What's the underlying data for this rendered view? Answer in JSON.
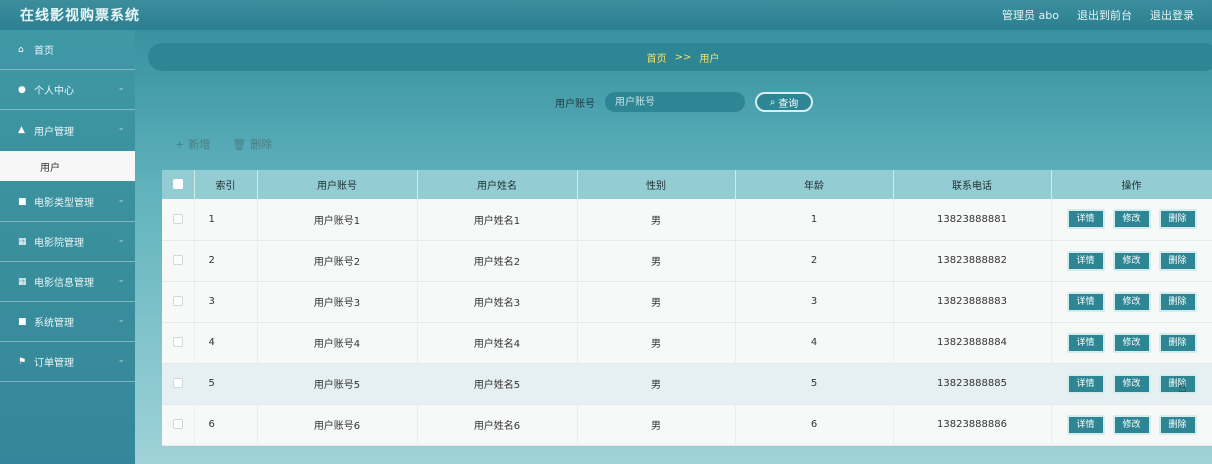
{
  "app": {
    "title": "在线影视购票系统"
  },
  "topbar": {
    "admin_label": "管理员 abo",
    "back_label": "退出到前台",
    "logout_label": "退出登录"
  },
  "sidebar": {
    "items": [
      {
        "label": "首页",
        "icon": "home-icon"
      },
      {
        "label": "个人中心",
        "icon": "user-icon"
      },
      {
        "label": "用户管理",
        "icon": "users-icon",
        "sub": "用户"
      },
      {
        "label": "电影类型管理",
        "icon": "folder-icon"
      },
      {
        "label": "电影院管理",
        "icon": "grid-icon"
      },
      {
        "label": "电影信息管理",
        "icon": "grid-icon"
      },
      {
        "label": "系统管理",
        "icon": "lock-icon"
      },
      {
        "label": "订单管理",
        "icon": "flag-icon"
      }
    ]
  },
  "breadcrumb": {
    "home": "首页",
    "sep": ">>",
    "current": "用户"
  },
  "search": {
    "label": "用户账号",
    "placeholder": "用户账号",
    "button": "查询"
  },
  "actions": {
    "add": "新增",
    "delete": "删除"
  },
  "table": {
    "columns": [
      "索引",
      "用户账号",
      "用户姓名",
      "性别",
      "年龄",
      "联系电话",
      "操作"
    ],
    "rows": [
      {
        "index": "1",
        "account": "用户账号1",
        "name": "用户姓名1",
        "gender": "男",
        "age": "1",
        "phone": "13823888881"
      },
      {
        "index": "2",
        "account": "用户账号2",
        "name": "用户姓名2",
        "gender": "男",
        "age": "2",
        "phone": "13823888882"
      },
      {
        "index": "3",
        "account": "用户账号3",
        "name": "用户姓名3",
        "gender": "男",
        "age": "3",
        "phone": "13823888883"
      },
      {
        "index": "4",
        "account": "用户账号4",
        "name": "用户姓名4",
        "gender": "男",
        "age": "4",
        "phone": "13823888884"
      },
      {
        "index": "5",
        "account": "用户账号5",
        "name": "用户姓名5",
        "gender": "男",
        "age": "5",
        "phone": "13823888885"
      },
      {
        "index": "6",
        "account": "用户账号6",
        "name": "用户姓名6",
        "gender": "男",
        "age": "6",
        "phone": "13823888886"
      }
    ],
    "ops": {
      "detail": "详情",
      "edit": "修改",
      "delete": "删除"
    }
  }
}
